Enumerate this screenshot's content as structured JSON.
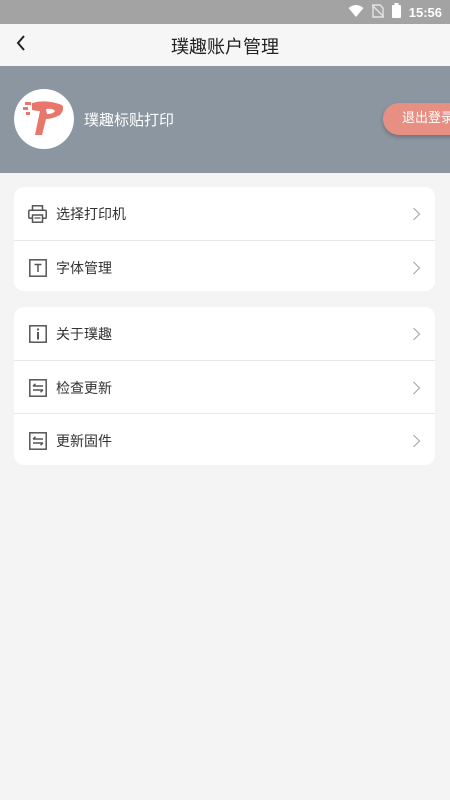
{
  "status_bar": {
    "time": "15:56"
  },
  "header": {
    "title": "璞趣账户管理"
  },
  "account": {
    "name": "璞趣标贴打印",
    "logout_label": "退出登录"
  },
  "menu_groups": [
    {
      "items": [
        {
          "label": "选择打印机",
          "icon": "printer-icon"
        },
        {
          "label": "字体管理",
          "icon": "font-icon"
        }
      ]
    },
    {
      "items": [
        {
          "label": "关于璞趣",
          "icon": "info-icon"
        },
        {
          "label": "检查更新",
          "icon": "swap-icon"
        },
        {
          "label": "更新固件",
          "icon": "swap-icon"
        }
      ]
    }
  ],
  "colors": {
    "status_bar": "#a3a3a3",
    "account_banner": "#8b96a1",
    "logout_button": "#e88f84",
    "logo_red": "#e8766b"
  }
}
